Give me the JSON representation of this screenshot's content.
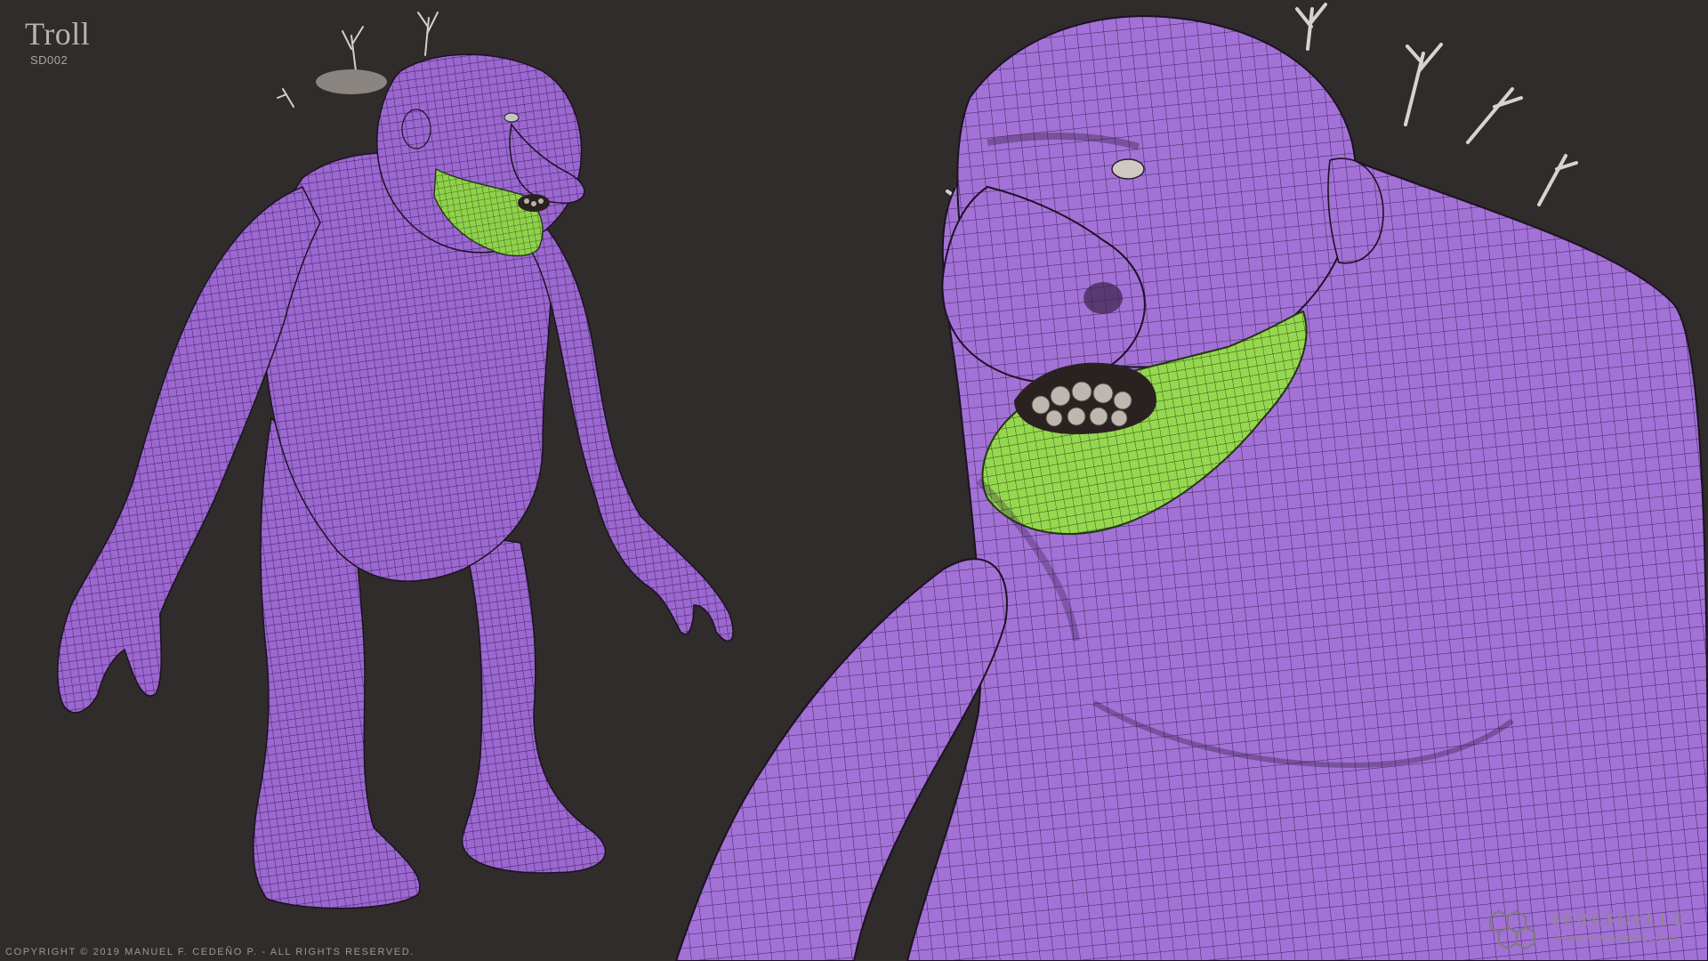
{
  "header": {
    "title": "Troll",
    "subtitle": "SD002"
  },
  "footer": {
    "copyright": "COPYRIGHT © 2019 MANUEL F. CEDEÑO P.  -  ALL RIGHTS RESERVED."
  },
  "brand": {
    "name": "SERESDELLE",
    "url": "www.seresdelle.com",
    "logo_icon": "hexagon-cluster-icon"
  },
  "colors": {
    "background": "#2f2c2b",
    "skin": "#9a66cf",
    "wireframe": "#3a1e57",
    "jaw": "#8fd24a",
    "branches": "#d7d3cf",
    "teeth": "#b8b2ab"
  },
  "scene": {
    "left_view": "full-body-troll-mesh",
    "right_view": "closeup-troll-head-mesh"
  }
}
